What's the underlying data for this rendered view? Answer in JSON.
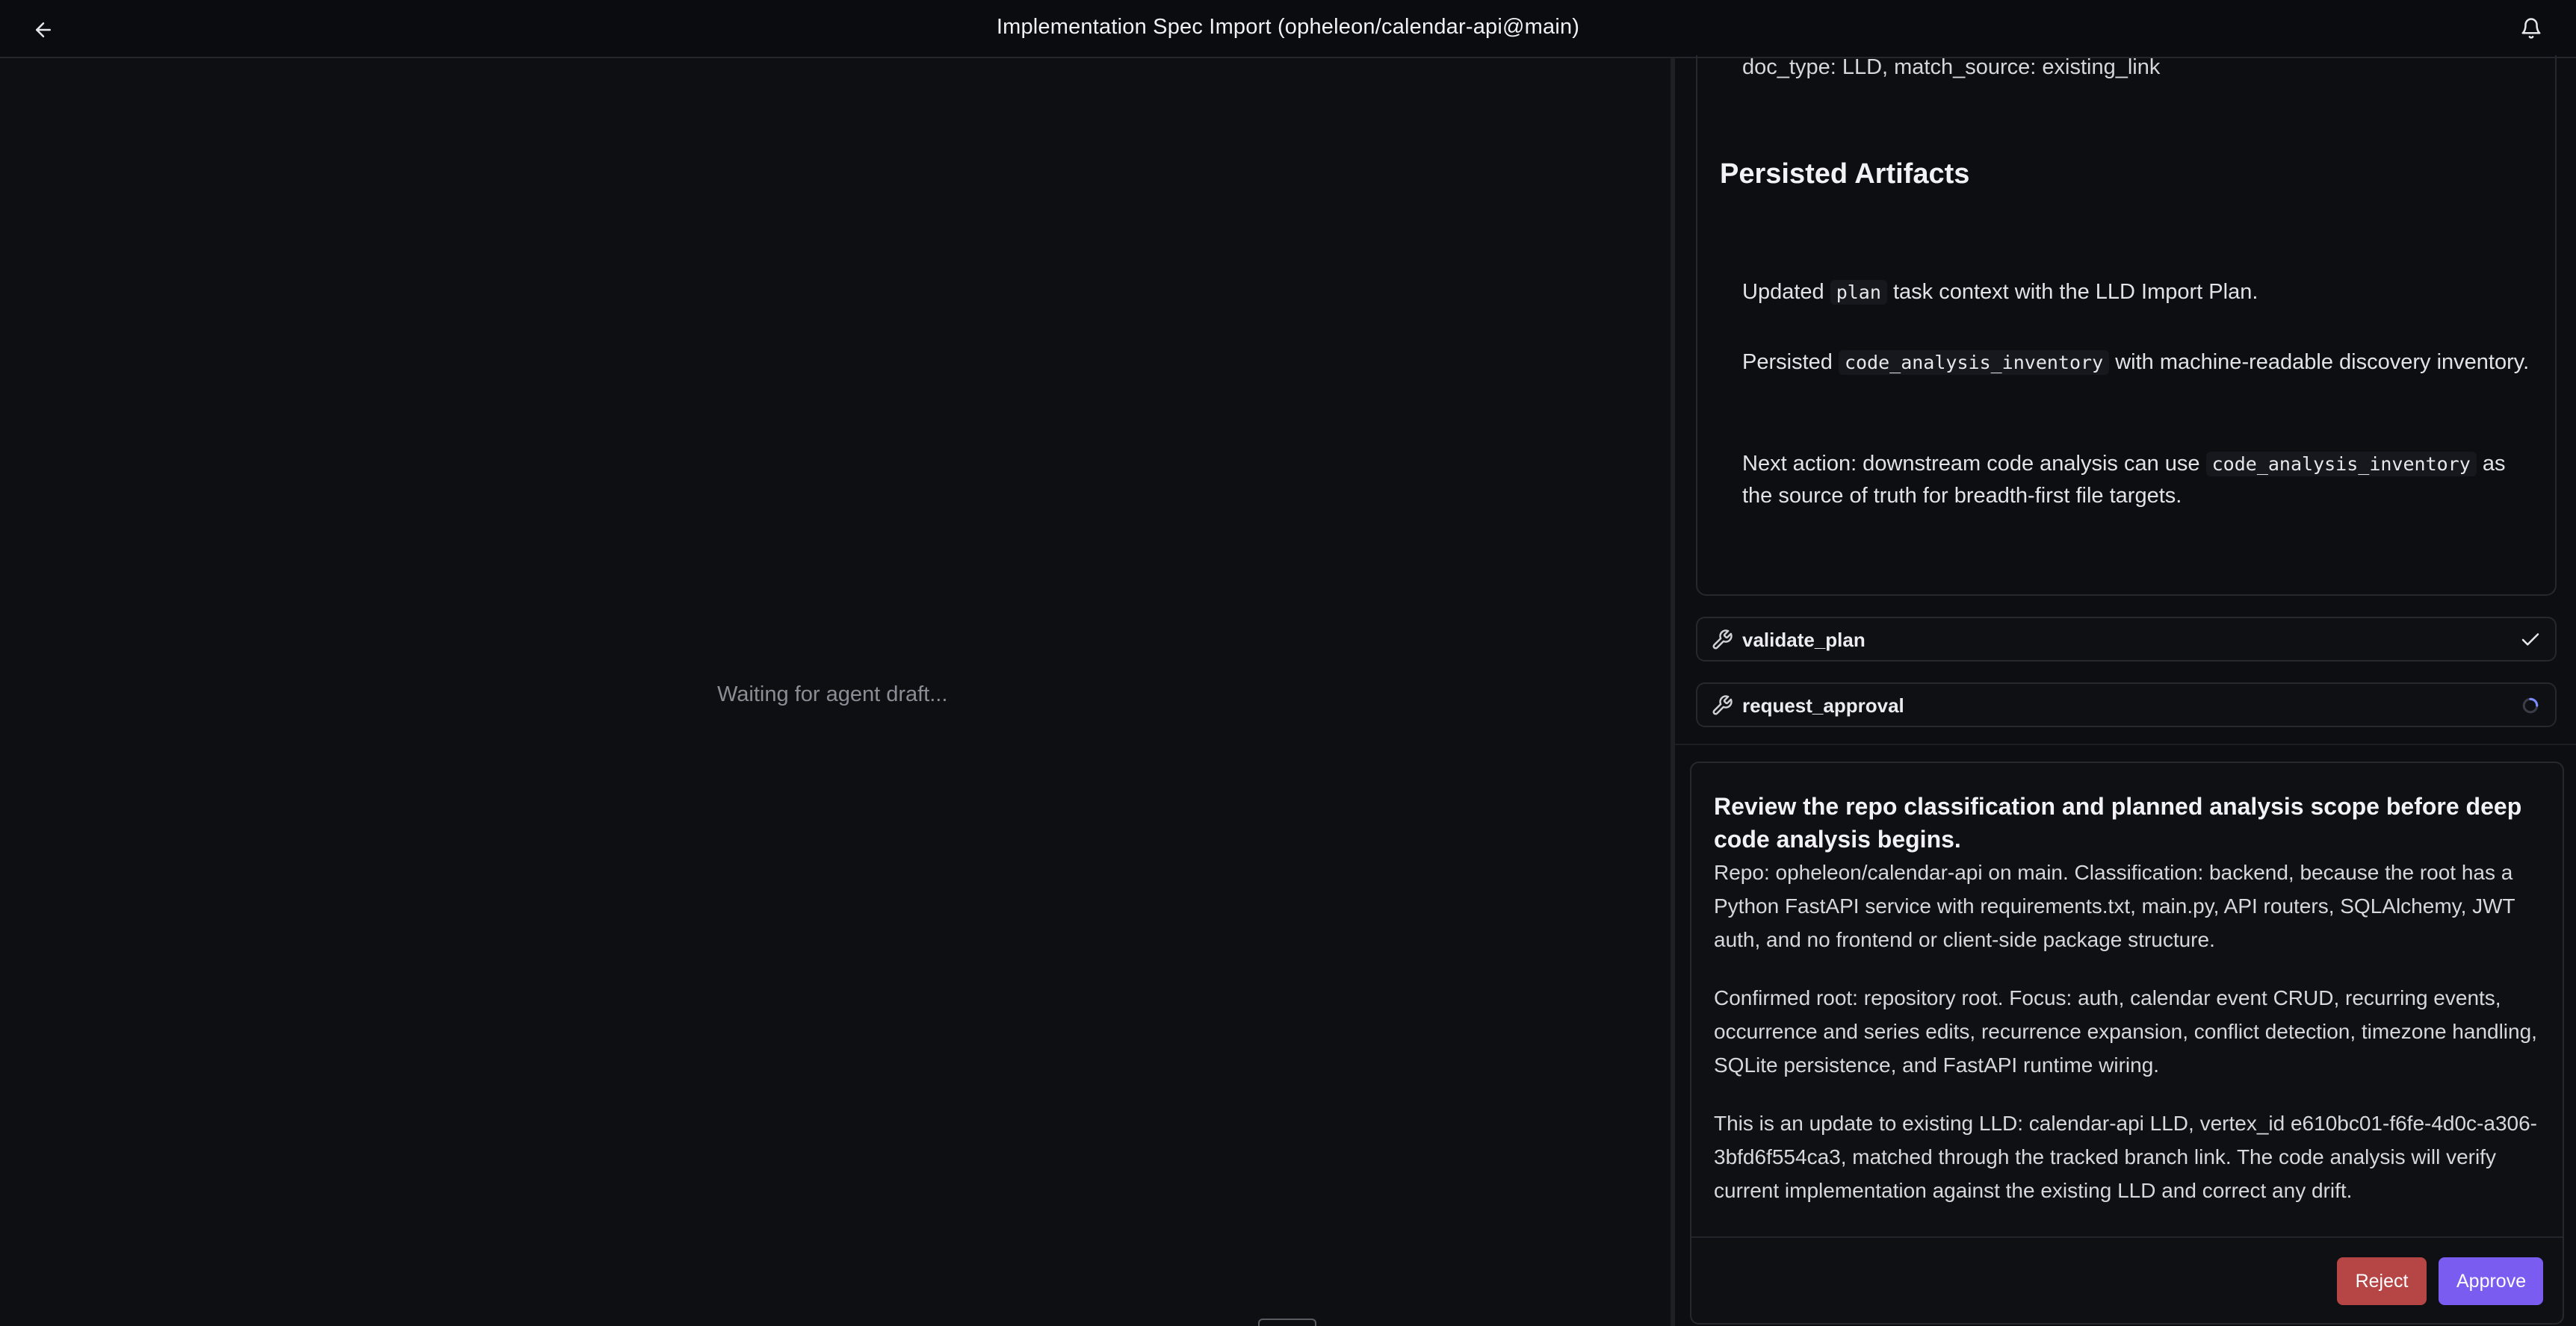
{
  "header": {
    "title": "Implementation Spec Import (opheleon/calendar-api@main)",
    "back_icon": "arrow-left-icon",
    "bell_icon": "bell-icon"
  },
  "left_panel": {
    "waiting_text": "Waiting for agent draft..."
  },
  "output_card": {
    "cut_line": "doc_type: LLD, match_source: existing_link",
    "heading": "Persisted Artifacts",
    "p1": {
      "pre": "Updated ",
      "code": "plan",
      "post": " task context with the LLD Import Plan."
    },
    "p2": {
      "pre": "Persisted ",
      "code": "code_analysis_inventory",
      "post": " with machine-readable discovery inventory."
    },
    "p3": {
      "pre": "Next action: downstream code analysis can use ",
      "code": "code_analysis_inventory",
      "post": " as the source of truth for breadth-first file targets."
    }
  },
  "tools": [
    {
      "name": "validate_plan",
      "status": "done"
    },
    {
      "name": "request_approval",
      "status": "running"
    }
  ],
  "review": {
    "title": "Review the repo classification and planned analysis scope before deep code analysis begins.",
    "p1": "Repo: opheleon/calendar-api on main. Classification: backend, because the root has a Python FastAPI service with requirements.txt, main.py, API routers, SQLAlchemy, JWT auth, and no frontend or client-side package structure.",
    "p2": "Confirmed root: repository root. Focus: auth, calendar event CRUD, recurring events, occurrence and series edits, recurrence expansion, conflict detection, timezone handling, SQLite persistence, and FastAPI runtime wiring.",
    "p3": "This is an update to existing LLD: calendar-api LLD, vertex_id e610bc01-f6fe-4d0c-a306-3bfd6f554ca3, matched through the tracked branch link. The code analysis will verify current implementation against the existing LLD and correct any drift.",
    "reject_label": "Reject",
    "approve_label": "Approve"
  },
  "colors": {
    "reject": "#b64545",
    "approve": "#7b5cf0",
    "background": "#0e0f13"
  }
}
